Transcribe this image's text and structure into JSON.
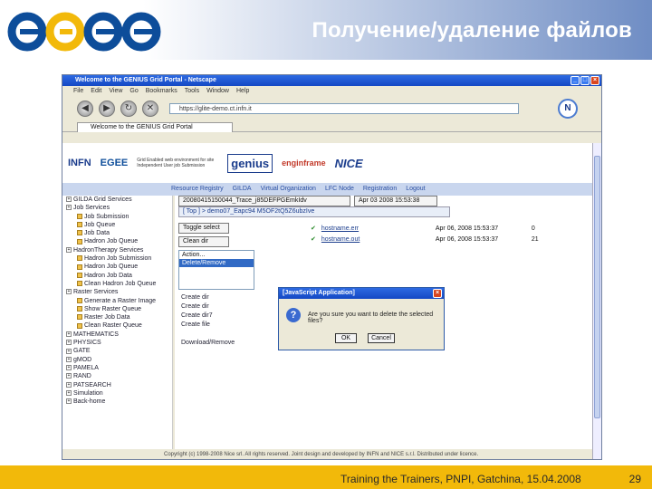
{
  "slide": {
    "title": "Получение/удаление файлов",
    "footer": "Training the Trainers, PNPI, Gatchina, 15.04.2008",
    "page": "29",
    "logo_text": "egee"
  },
  "browser": {
    "window_title": "Welcome to the GENIUS Grid Portal - Netscape",
    "menu": [
      "File",
      "Edit",
      "View",
      "Go",
      "Bookmarks",
      "Tools",
      "Window",
      "Help"
    ],
    "url": "https://glite-demo.ct.infn.it",
    "tab_title": "Welcome to the GENIUS Grid Portal"
  },
  "portal": {
    "logos": [
      "INFN",
      "EGEE",
      "Grid Enabled web environment for site Independent User job Submission",
      "genius",
      "enginframe",
      "NICE"
    ],
    "links": [
      "Resource Registry",
      "GILDA",
      "Virtual Organization",
      "LFC Node",
      "Registration",
      "Logout"
    ],
    "tree": [
      {
        "label": "GILDA Grid Services",
        "kind": "folder"
      },
      {
        "label": "Job Services",
        "kind": "folder"
      },
      {
        "label": "Job Submission",
        "kind": "file"
      },
      {
        "label": "Job Queue",
        "kind": "file"
      },
      {
        "label": "Job Data",
        "kind": "file"
      },
      {
        "label": "Hadron Job Queue",
        "kind": "file"
      },
      {
        "label": "HadronTherapy Services",
        "kind": "folder"
      },
      {
        "label": "Hadron Job Submission",
        "kind": "file"
      },
      {
        "label": "Hadron Job Queue",
        "kind": "file"
      },
      {
        "label": "Hadron Job Data",
        "kind": "file"
      },
      {
        "label": "Clean Hadron Job Queue",
        "kind": "file"
      },
      {
        "label": "Raster Services",
        "kind": "folder"
      },
      {
        "label": "Generate a Raster Image",
        "kind": "file"
      },
      {
        "label": "Show Raster Queue",
        "kind": "file"
      },
      {
        "label": "Raster Job Data",
        "kind": "file"
      },
      {
        "label": "Clean Raster Queue",
        "kind": "file"
      },
      {
        "label": "MATHEMATICS",
        "kind": "folder"
      },
      {
        "label": "PHYSICS",
        "kind": "folder"
      },
      {
        "label": "GATE",
        "kind": "folder"
      },
      {
        "label": "gMOD",
        "kind": "folder"
      },
      {
        "label": "PAMELA",
        "kind": "folder"
      },
      {
        "label": "RAND",
        "kind": "folder"
      },
      {
        "label": "PATSEARCH",
        "kind": "folder"
      },
      {
        "label": "Simulation",
        "kind": "folder"
      },
      {
        "label": "Back-home",
        "kind": "folder"
      }
    ],
    "job_dropdown": "20080415150044_Trace_j85DEFPGEmkIdv",
    "date_field": "Apr 03 2008 15:53:38",
    "path": "[ Top ] > demo07_Eapc94 M5OF2tQ5Z6ubzIve",
    "toggle_label": "Toggle select",
    "clean_label": "Clean dir",
    "action_label": "Action...",
    "actions": [
      "Action...",
      "Delete/Remove",
      "",
      ""
    ],
    "actions_extra": [
      "Create dir",
      "Create dir",
      "Create dir7",
      "Create file",
      "",
      "Download/Remove"
    ],
    "files": [
      {
        "name": "hostname.err",
        "date": "Apr 06, 2008 15:53:37",
        "size": "0"
      },
      {
        "name": "hostname.out",
        "date": "Apr 06, 2008 15:53:37",
        "size": "21"
      }
    ],
    "copyright": "Copyright (c) 1998-2008 Nice srl. All rights reserved. Joint design and developed by INFN and NICE s.r.l. Distributed under licence."
  },
  "dialog": {
    "title": "[JavaScript Application]",
    "message": "Are you sure you want to delete the selected files?",
    "ok": "OK",
    "cancel": "Cancel"
  },
  "colors": {
    "header_blue": "#6f8dc4",
    "footer_gold": "#f2b90a",
    "xp_blue": "#1448c4"
  }
}
